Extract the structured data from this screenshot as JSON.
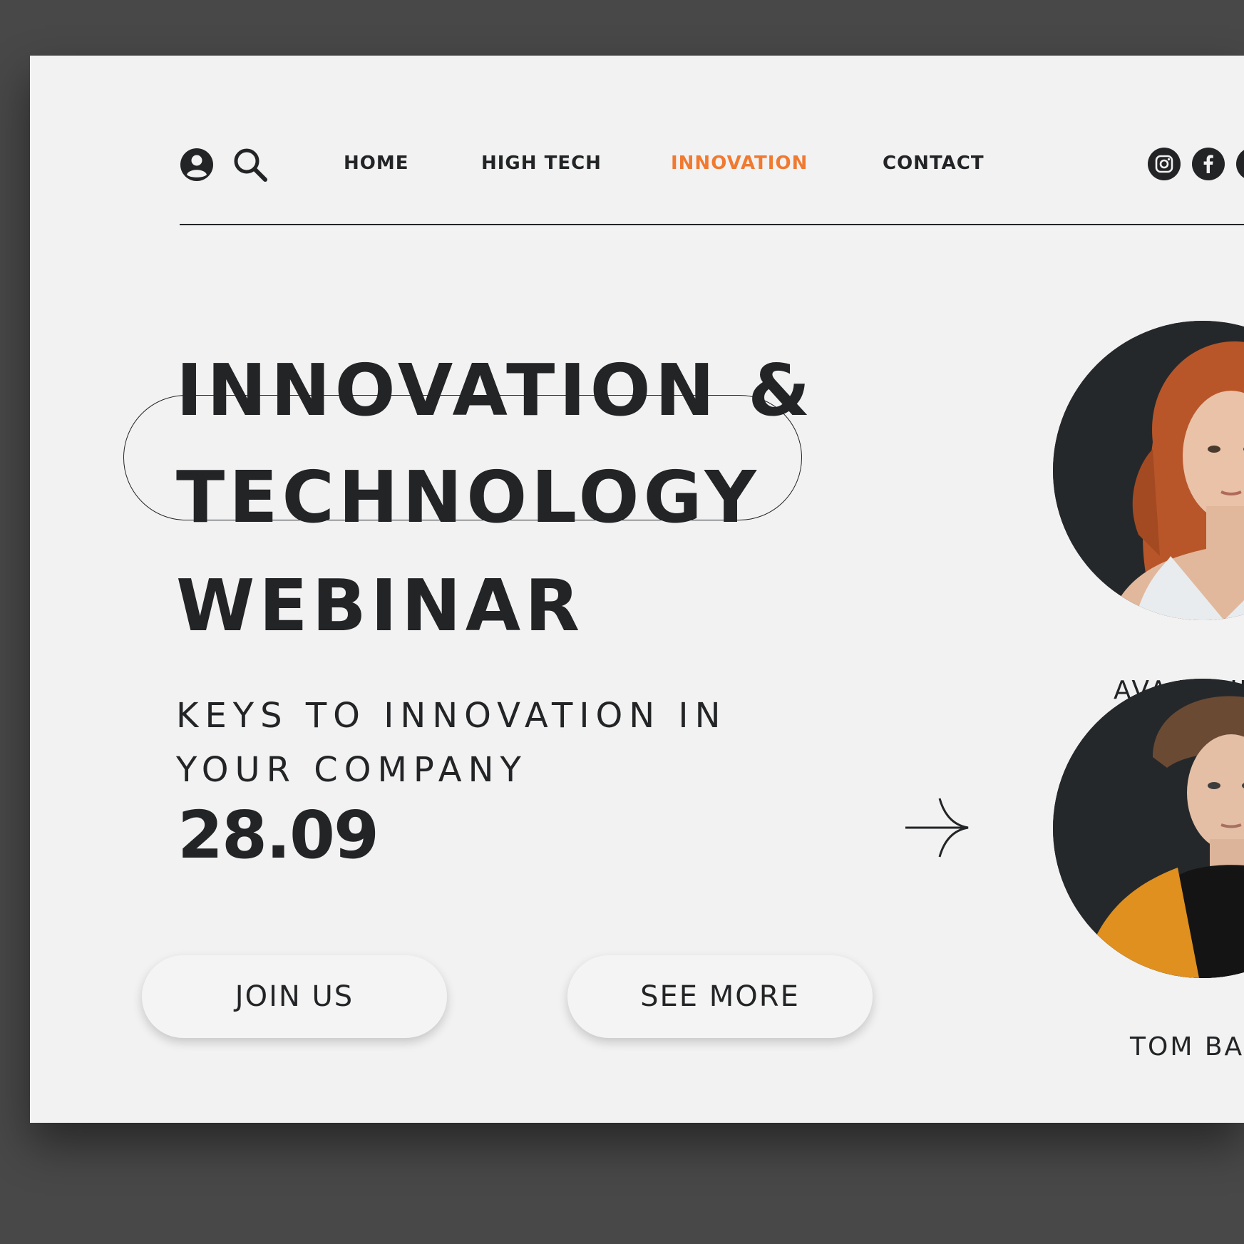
{
  "nav": {
    "user_icon": "user-icon",
    "search_icon": "search-icon",
    "links": [
      {
        "label": "HOME"
      },
      {
        "label": "HIGH TECH"
      },
      {
        "label": "INNOVATION",
        "active": true
      },
      {
        "label": "CONTACT"
      }
    ],
    "social": [
      "instagram-icon",
      "facebook-icon",
      "social-icon"
    ]
  },
  "hero": {
    "line1": "INNOVATION &",
    "line2": "TECHNOLOGY",
    "line3": "WEBINAR",
    "subtitle_line1": "KEYS TO INNOVATION IN",
    "subtitle_line2": "YOUR COMPANY",
    "date": "28.09"
  },
  "buttons": {
    "join": "JOIN US",
    "see_more": "SEE MORE"
  },
  "speakers": [
    {
      "name": "AVA YOUN"
    },
    {
      "name": "TOM BAK"
    }
  ],
  "colors": {
    "accent": "#f07a30",
    "text": "#222426",
    "background": "#f2f2f2",
    "outer": "#484848"
  }
}
